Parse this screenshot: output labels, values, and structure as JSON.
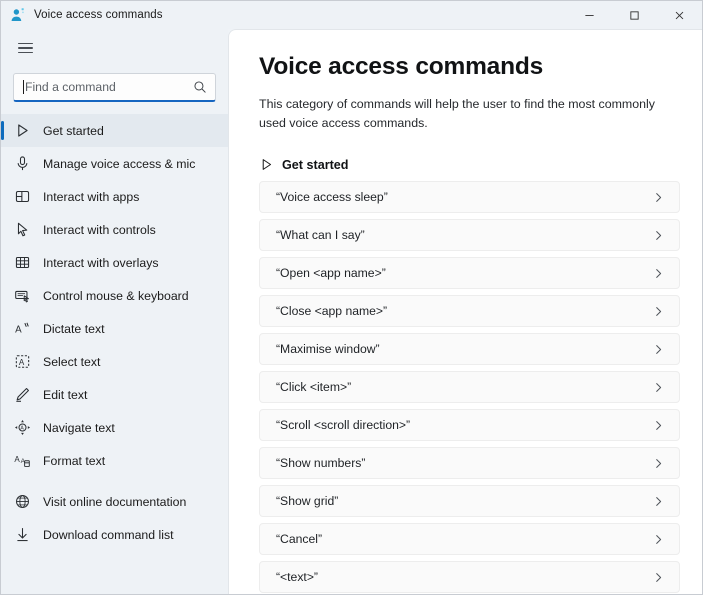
{
  "window": {
    "title": "Voice access commands",
    "app_icon": "voice-access-person-icon",
    "controls": {
      "minimize": "─",
      "maximize": "☐",
      "close": "✕"
    }
  },
  "sidebar": {
    "menu_icon": "hamburger-menu-icon",
    "search": {
      "placeholder": "Find a command",
      "value": "",
      "icon": "search-icon"
    },
    "items": [
      {
        "label": "Get started",
        "icon": "play-triangle-icon",
        "selected": true
      },
      {
        "label": "Manage voice access & mic",
        "icon": "microphone-icon",
        "selected": false
      },
      {
        "label": "Interact with apps",
        "icon": "apps-grid-icon",
        "selected": false
      },
      {
        "label": "Interact with controls",
        "icon": "mouse-pointer-icon",
        "selected": false
      },
      {
        "label": "Interact with overlays",
        "icon": "grid-overlay-icon",
        "selected": false
      },
      {
        "label": "Control mouse & keyboard",
        "icon": "keyboard-mouse-icon",
        "selected": false
      },
      {
        "label": "Dictate text",
        "icon": "dictate-text-icon",
        "selected": false
      },
      {
        "label": "Select text",
        "icon": "select-text-icon",
        "selected": false
      },
      {
        "label": "Edit text",
        "icon": "edit-text-pen-icon",
        "selected": false
      },
      {
        "label": "Navigate text",
        "icon": "navigate-text-arrows-icon",
        "selected": false
      },
      {
        "label": "Format text",
        "icon": "format-text-icon",
        "selected": false
      }
    ],
    "bottom_items": [
      {
        "label": "Visit online documentation",
        "icon": "globe-icon"
      },
      {
        "label": "Download command list",
        "icon": "download-arrow-icon"
      }
    ]
  },
  "main": {
    "title": "Voice access commands",
    "description": "This category of commands will help the user to find the most commonly used voice access commands.",
    "section": {
      "label": "Get started",
      "icon": "play-triangle-icon"
    },
    "chevron_icon": "chevron-right-icon",
    "commands": [
      {
        "label": "“Voice access sleep”"
      },
      {
        "label": "“What can I say”"
      },
      {
        "label": "“Open <app name>”"
      },
      {
        "label": "“Close <app name>”"
      },
      {
        "label": "“Maximise window”"
      },
      {
        "label": "“Click <item>”"
      },
      {
        "label": "“Scroll <scroll direction>”"
      },
      {
        "label": "“Show numbers”"
      },
      {
        "label": "“Show grid”"
      },
      {
        "label": "“Cancel”"
      },
      {
        "label": "“<text>”"
      }
    ]
  },
  "colors": {
    "accent": "#0f6cbd",
    "sidebar_bg": "#eef2f6",
    "main_bg": "#ffffff",
    "row_bg": "#fafafa",
    "search_underline": "#1565c0"
  }
}
